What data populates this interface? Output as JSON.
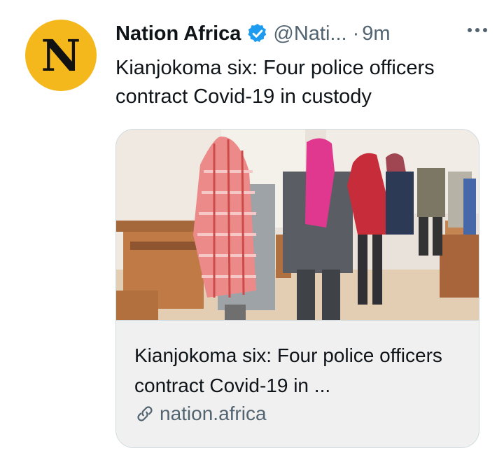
{
  "author": {
    "avatar_letter": "N",
    "avatar_color": "#f5b81c",
    "name": "Nation Africa",
    "handle": "@Nati...",
    "separator": "·",
    "time": "9m",
    "verified_icon": "verified-badge-icon",
    "verified_color": "#1d9bf0"
  },
  "tweet": {
    "text": "Kianjokoma six: Four police officers contract Covid-19 in custody"
  },
  "card": {
    "title": "Kianjokoma six: Four police officers contract Covid-19 in ...",
    "domain": "nation.africa",
    "link_icon": "link-icon"
  },
  "icons": {
    "more": "more-icon"
  }
}
